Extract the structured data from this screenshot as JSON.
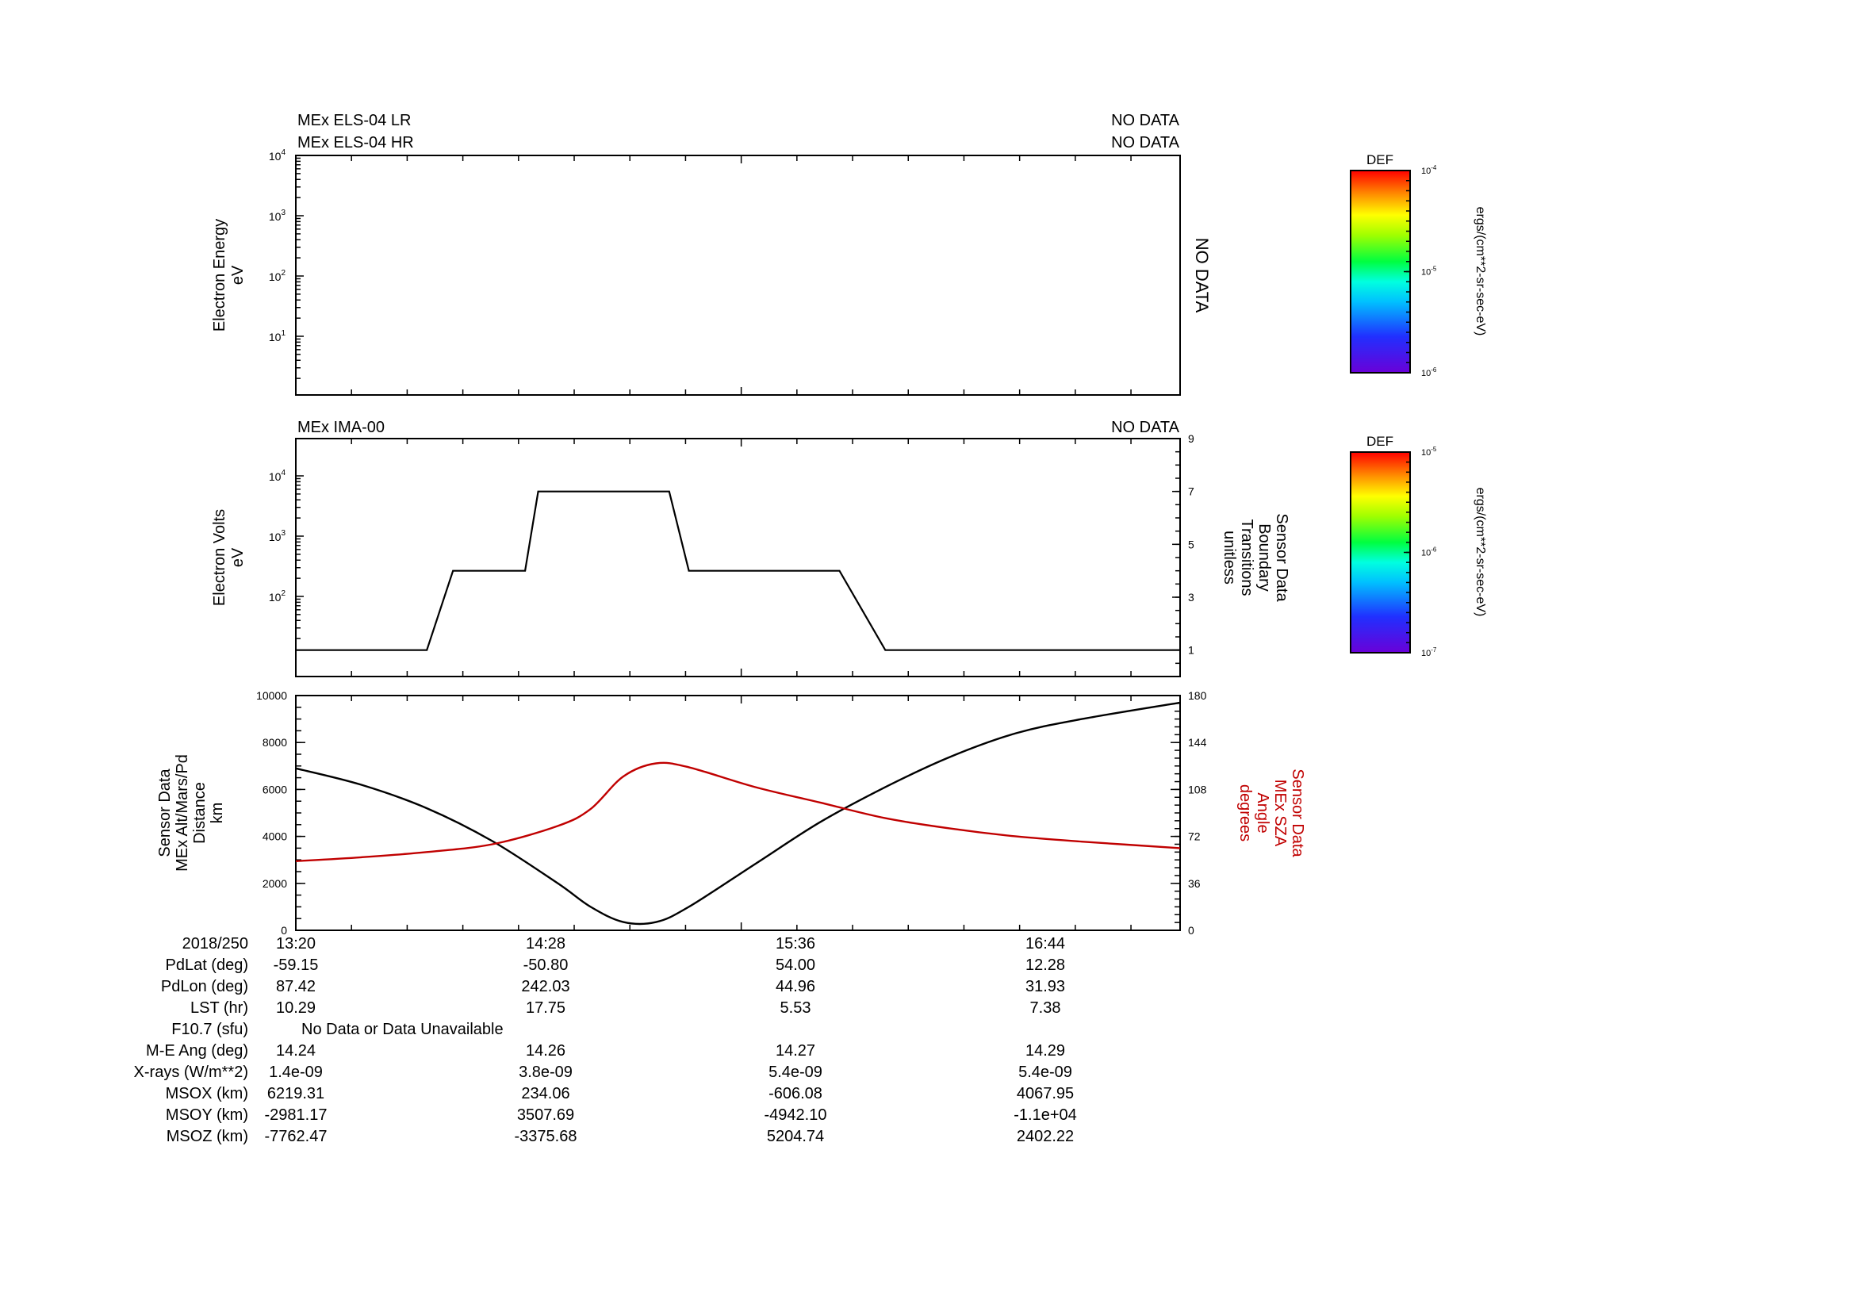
{
  "panels": {
    "els": {
      "label_lr": "MEx ELS-04 LR",
      "label_hr": "MEx ELS-04 HR",
      "status_lr": "NO DATA",
      "status_hr": "NO DATA",
      "ylabel_line1": "Electron Energy",
      "ylabel_line2": "eV",
      "side_text": "NO DATA",
      "yticks": [
        "10",
        "10",
        "10",
        "10"
      ],
      "ytick_exp": [
        "4",
        "3",
        "2",
        "1"
      ]
    },
    "ima": {
      "label": "MEx IMA-00",
      "status": "NO DATA",
      "ylabel_line1": "Electron Volts",
      "ylabel_line2": "eV",
      "yticks": [
        "10",
        "10",
        "10"
      ],
      "ytick_exp": [
        "4",
        "3",
        "2"
      ],
      "right_label": [
        "Sensor Data",
        "Boundary",
        "Transitions",
        "unitless"
      ],
      "right_ticks": [
        "9",
        "7",
        "5",
        "3",
        "1"
      ]
    },
    "orbit": {
      "ylabel": [
        "Sensor Data",
        "MEx Alt/Mars/Pd",
        "Distance",
        "km"
      ],
      "right_label": [
        "Sensor Data",
        "MEx SZA",
        "Angle",
        "degrees"
      ],
      "left_ticks": [
        "10000",
        "8000",
        "6000",
        "4000",
        "2000",
        "0"
      ],
      "right_ticks": [
        "180",
        "144",
        "108",
        "72",
        "36",
        "0"
      ]
    }
  },
  "colorbars": [
    {
      "title": "DEF",
      "ticks": [
        "10",
        "10",
        "10"
      ],
      "tick_exp": [
        "-4",
        "-5",
        "-6"
      ],
      "unit": "ergs/(cm**2-sr-sec-eV)"
    },
    {
      "title": "DEF",
      "ticks": [
        "10",
        "10",
        "10"
      ],
      "tick_exp": [
        "-5",
        "-6",
        "-7"
      ],
      "unit": "ergs/(cm**2-sr-sec-eV)"
    }
  ],
  "ephemeris": {
    "date": "2018/250",
    "times": [
      "13:20",
      "14:28",
      "15:36",
      "16:44"
    ],
    "rows": [
      {
        "label": "PdLat (deg)",
        "values": [
          "-59.15",
          "-50.80",
          "54.00",
          "12.28"
        ]
      },
      {
        "label": "PdLon (deg)",
        "values": [
          "87.42",
          "242.03",
          "44.96",
          "31.93"
        ]
      },
      {
        "label": "LST (hr)",
        "values": [
          "10.29",
          "17.75",
          "5.53",
          "7.38"
        ]
      },
      {
        "label": "F10.7 (sfu)",
        "span": "No Data or Data Unavailable"
      },
      {
        "label": "M-E Ang (deg)",
        "values": [
          "14.24",
          "14.26",
          "14.27",
          "14.29"
        ]
      },
      {
        "label": "X-rays (W/m**2)",
        "values": [
          "1.4e-09",
          "3.8e-09",
          "5.4e-09",
          "5.4e-09"
        ]
      },
      {
        "label": "MSOX (km)",
        "values": [
          "6219.31",
          "234.06",
          "-606.08",
          "4067.95"
        ]
      },
      {
        "label": "MSOY (km)",
        "values": [
          "-2981.17",
          "3507.69",
          "-4942.10",
          "-1.1e+04"
        ]
      },
      {
        "label": "MSOZ (km)",
        "values": [
          "-7762.47",
          "-3375.68",
          "5204.74",
          "2402.22"
        ]
      }
    ]
  },
  "chart_data": [
    {
      "type": "line",
      "panel": "ima",
      "title": "MEx IMA-00",
      "ylabel": "Electron Volts eV",
      "y2label": "Sensor Data Boundary Transitions unitless",
      "x_unit": "minutes after 13:20",
      "x": [
        0,
        20,
        24,
        35,
        37,
        48,
        50,
        57,
        60,
        81,
        83,
        90,
        92,
        100,
        135
      ],
      "values": [
        1,
        1,
        4,
        4,
        7,
        7,
        7,
        7,
        4,
        4,
        4,
        1,
        1,
        1,
        1
      ],
      "y2lim": [
        0,
        9
      ]
    },
    {
      "type": "line",
      "panel": "orbit",
      "x_unit": "minutes after 13:20",
      "xlim": [
        0,
        135
      ],
      "ylim": [
        0,
        10000
      ],
      "y2lim": [
        0,
        180
      ],
      "series": [
        {
          "name": "MEx Alt/Mars/Pd",
          "axis": "left",
          "color": "#000000",
          "x": [
            0,
            10,
            20,
            30,
            40,
            45,
            50,
            55,
            60,
            70,
            80,
            90,
            100,
            110,
            120,
            135
          ],
          "values": [
            6900,
            6200,
            5200,
            3800,
            2000,
            1000,
            350,
            350,
            1000,
            2800,
            4600,
            6100,
            7400,
            8400,
            9000,
            9700
          ]
        },
        {
          "name": "MEx SZA",
          "axis": "right",
          "color": "#c00000",
          "x": [
            0,
            10,
            20,
            30,
            40,
            45,
            50,
            55,
            60,
            70,
            80,
            90,
            100,
            110,
            120,
            135
          ],
          "values": [
            53,
            56,
            60,
            66,
            80,
            93,
            118,
            128,
            125,
            110,
            98,
            86,
            78,
            72,
            68,
            63
          ]
        }
      ]
    }
  ]
}
